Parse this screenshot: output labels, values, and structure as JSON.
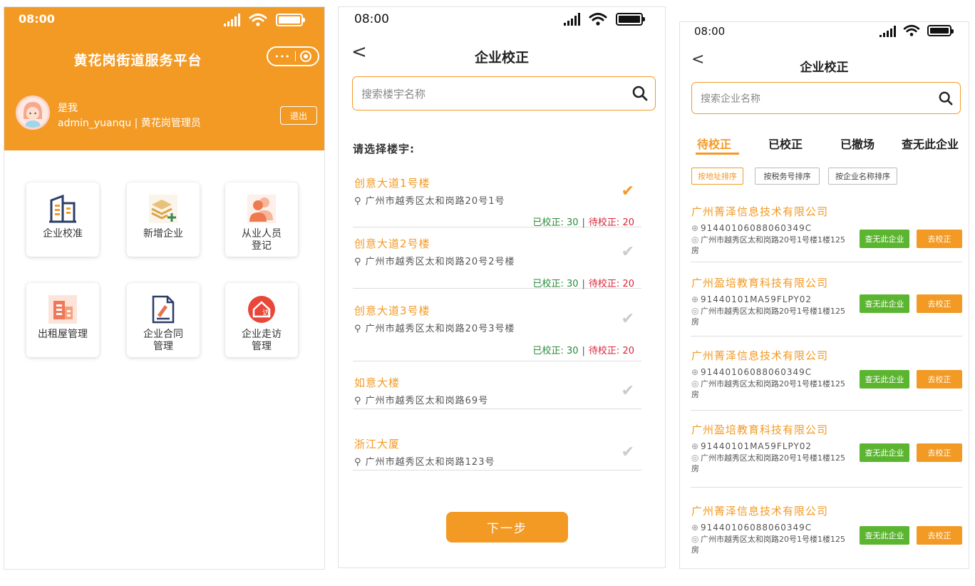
{
  "colors": {
    "accent": "#F39A25",
    "success": "#5CB531",
    "done_text": "#2a8a3a",
    "pending_text": "#d8253a"
  },
  "phone1": {
    "status": {
      "time": "08:00"
    },
    "title": "黄花岗街道服务平台",
    "capsule": {
      "dots": "•••"
    },
    "user": {
      "name": "是我",
      "role": "admin_yuanqu | 黄花岗管理员",
      "logout": "退出"
    },
    "tiles": [
      {
        "label": "企业校准",
        "icon": "building-icon"
      },
      {
        "label": "新增企业",
        "icon": "add-layers-icon"
      },
      {
        "label": "从业人员\n登记",
        "icon": "people-icon"
      },
      {
        "label": "出租屋管理",
        "icon": "rental-house-icon"
      },
      {
        "label": "企业合同\n管理",
        "icon": "contract-icon"
      },
      {
        "label": "企业走访\n管理",
        "icon": "visit-icon"
      }
    ]
  },
  "phone2": {
    "status": {
      "time": "08:00"
    },
    "nav": {
      "back": "<",
      "title": "企业校正"
    },
    "search": {
      "placeholder": "搜索楼宇名称"
    },
    "prompt": "请选择楼宇:",
    "buildings": [
      {
        "name": "创意大道1号楼",
        "address": "广州市越秀区太和岗路20号1号",
        "selected": true,
        "done_label": "已校正:",
        "done": "30",
        "pending_label": "待校正:",
        "pending": "20",
        "sep": "|"
      },
      {
        "name": "创意大道2号楼",
        "address": "广州市越秀区太和岗路20号2号楼",
        "selected": false,
        "done_label": "已校正:",
        "done": "30",
        "pending_label": "待校正:",
        "pending": "20",
        "sep": "|"
      },
      {
        "name": "创意大道3号楼",
        "address": "广州市越秀区太和岗路20号3号楼",
        "selected": false,
        "done_label": "已校正:",
        "done": "30",
        "pending_label": "待校正:",
        "pending": "20",
        "sep": "|"
      },
      {
        "name": "如意大楼",
        "address": "广州市越秀区太和岗路69号",
        "selected": false
      },
      {
        "name": "浙江大厦",
        "address": "广州市越秀区太和岗路123号",
        "selected": false
      }
    ],
    "next": "下一步"
  },
  "phone3": {
    "status": {
      "time": "08:00"
    },
    "nav": {
      "back": "<",
      "title": "企业校正"
    },
    "search": {
      "placeholder": "搜索企业名称"
    },
    "tabs": [
      "待校正",
      "已校正",
      "已撤场",
      "查无此企业"
    ],
    "active_tab": 0,
    "sorts": [
      "按地址排序",
      "按税务号排序",
      "按企业名称排序"
    ],
    "active_sort": 0,
    "btn_none": "查无此企业",
    "btn_fix": "去校正",
    "enterprises": [
      {
        "name": "广州菁泽信息技术有限公司",
        "code": "91440106088060349C",
        "address": "广州市越秀区太和岗路20号1号楼1楼125房"
      },
      {
        "name": "广州盈培教育科技有限公司",
        "code": "91440101MA59FLPY02",
        "address": "广州市越秀区太和岗路20号1号楼1楼125房"
      },
      {
        "name": "广州菁泽信息技术有限公司",
        "code": "91440106088060349C",
        "address": "广州市越秀区太和岗路20号1号楼1楼125房"
      },
      {
        "name": "广州盈培教育科技有限公司",
        "code": "91440101MA59FLPY02",
        "address": "广州市越秀区太和岗路20号1号楼1楼125房"
      },
      {
        "name": "广州菁泽信息技术有限公司",
        "code": "91440106088060349C",
        "address": "广州市越秀区太和岗路20号1号楼1楼125房"
      }
    ]
  }
}
